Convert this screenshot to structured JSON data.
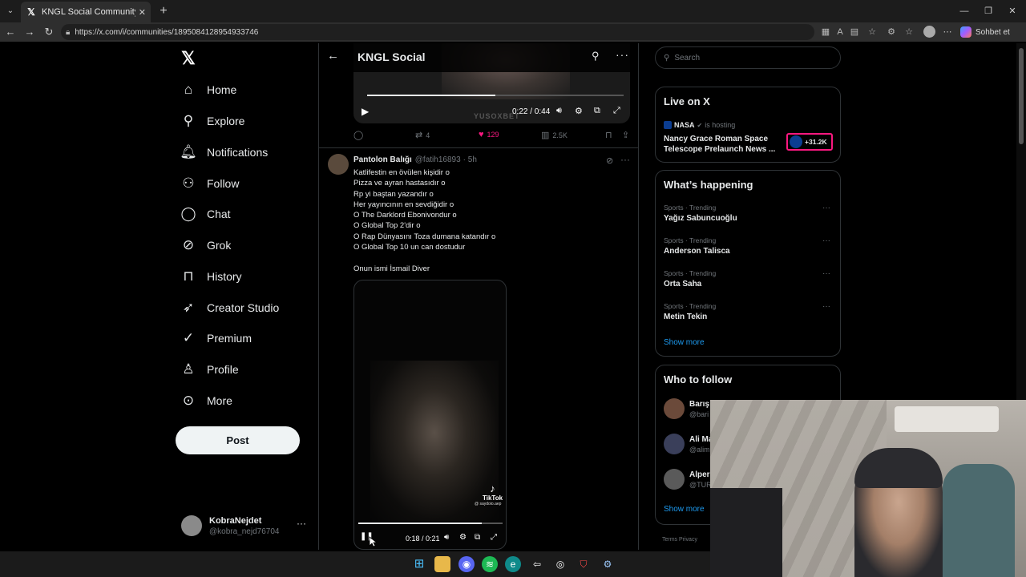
{
  "browser": {
    "tab_title": "KNGL Social Community / X",
    "url": "https://x.com/i/communities/1895084128954933746",
    "copilot_label": "Sohbet et"
  },
  "sidebar": {
    "items": [
      {
        "label": "Home",
        "icon": "home-icon"
      },
      {
        "label": "Explore",
        "icon": "search-icon"
      },
      {
        "label": "Notifications",
        "icon": "bell-icon"
      },
      {
        "label": "Follow",
        "icon": "person-add-icon"
      },
      {
        "label": "Chat",
        "icon": "chat-icon"
      },
      {
        "label": "Grok",
        "icon": "grok-icon"
      },
      {
        "label": "History",
        "icon": "bookmark-icon"
      },
      {
        "label": "Creator Studio",
        "icon": "rocket-icon"
      },
      {
        "label": "Premium",
        "icon": "verified-icon"
      },
      {
        "label": "Profile",
        "icon": "person-icon"
      },
      {
        "label": "More",
        "icon": "more-circle-icon"
      }
    ],
    "post_label": "Post",
    "account": {
      "name": "KobraNejdet",
      "handle": "@kobra_nejd76704"
    }
  },
  "header": {
    "title": "KNGL Social"
  },
  "video1": {
    "time": "0:22 / 0:44",
    "watermark": "YUSOXBET",
    "progress": 0.5
  },
  "actions1": {
    "reposts": "4",
    "likes": "129",
    "views": "2.5K"
  },
  "tweet2": {
    "name": "Pantolon Balığı",
    "handle": "@fatih16893",
    "time": "· 5h",
    "lines": [
      "Katlifestin en övülen kişidir o",
      "Pizza ve ayran hastasıdır o",
      "Rp yi baştan yazandır o",
      "Her yayıncının en sevdiğidir o",
      "O The Darklord Ebonivondur o",
      "O Global Top 2'dir o",
      "O Rap Dünyasını Toza dumana katandır o",
      "O Global Top 10 un can dostudur",
      "",
      "Onun ismi İsmail Diver"
    ]
  },
  "video2": {
    "time": "0:18 / 0:21",
    "tiktok_label": "TikTok",
    "tiktok_user": "@ saydoio.aep",
    "progress": 0.857
  },
  "right": {
    "search_placeholder": "Search",
    "live": {
      "title": "Live on X",
      "host": "NASA",
      "host_status": "is hosting",
      "show_title": "Nancy Grace Roman Space Telescope Prelaunch News ...",
      "count": "+31.2K"
    },
    "happening": {
      "title": "What’s happening",
      "trends": [
        {
          "meta": "Sports · Trending",
          "name": "Yağız Sabuncuoğlu"
        },
        {
          "meta": "Sports · Trending",
          "name": "Anderson Talisca"
        },
        {
          "meta": "Sports · Trending",
          "name": "Orta Saha"
        },
        {
          "meta": "Sports · Trending",
          "name": "Metin Tekin"
        }
      ],
      "show_more": "Show more"
    },
    "who_to_follow": {
      "title": "Who to follow",
      "people": [
        {
          "name": "Barış",
          "handle": "@bari",
          "color": "#6b4a3a"
        },
        {
          "name": "Ali Ma",
          "handle": "@alim",
          "color": "#3a3f5a"
        },
        {
          "name": "Alper",
          "handle": "@TUR",
          "color": "#5a5a5a"
        }
      ],
      "show_more": "Show more"
    },
    "footer": "Terms     Privacy"
  },
  "colors": {
    "accent": "#1d9bf0",
    "like": "#f91880",
    "background": "#000000"
  }
}
